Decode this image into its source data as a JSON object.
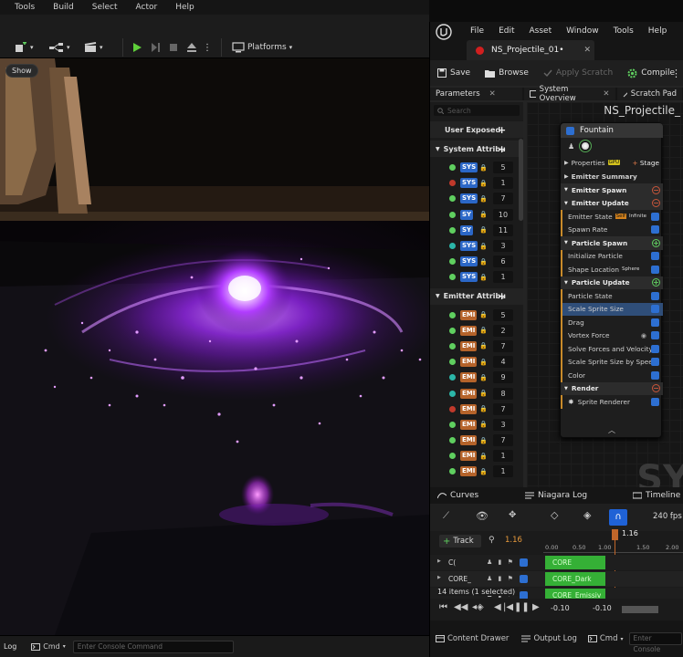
{
  "ue_menu": [
    "Tools",
    "Build",
    "Select",
    "Actor",
    "Help"
  ],
  "ue_toolbar": {
    "platforms_label": "Platforms"
  },
  "viewport": {
    "show_label": "Show"
  },
  "ue_bottom": {
    "log_label": "Log",
    "cmd_label": "Cmd",
    "console_placeholder": "Enter Console Command"
  },
  "niagara": {
    "menu": [
      "File",
      "Edit",
      "Asset",
      "Window",
      "Tools",
      "Help"
    ],
    "asset_tab": "NS_Projectile_01•",
    "toolbar": {
      "save": "Save",
      "browse": "Browse",
      "apply_scratch": "Apply Scratch",
      "compile": "Compile"
    },
    "panel_tabs": [
      "Parameters",
      "System Overview",
      "Scratch Pad"
    ],
    "search_placeholder": "Search",
    "graph_title": "NS_Projectile_",
    "watermark": "SY",
    "params": {
      "user_exposed": "User Exposed",
      "system_section": "System Attribu",
      "system_rows": [
        {
          "tag": "SYS",
          "val": "5",
          "dot": "#5fcf5f"
        },
        {
          "tag": "SYS",
          "val": "1",
          "dot": "#c0392b"
        },
        {
          "tag": "SYS",
          "val": "7",
          "dot": "#5fcf5f"
        },
        {
          "tag": "SY",
          "val": "10",
          "dot": "#5fcf5f"
        },
        {
          "tag": "SY",
          "val": "11",
          "dot": "#5fcf5f"
        },
        {
          "tag": "SYS",
          "val": "3",
          "dot": "#2bb6a8"
        },
        {
          "tag": "SYS",
          "val": "6",
          "dot": "#5fcf5f"
        },
        {
          "tag": "SYS",
          "val": "1",
          "dot": "#5fcf5f"
        }
      ],
      "emitter_section": "Emitter Attribu",
      "emitter_rows": [
        {
          "tag": "EMI",
          "val": "5",
          "dot": "#5fcf5f"
        },
        {
          "tag": "EMI",
          "val": "2",
          "dot": "#5fcf5f"
        },
        {
          "tag": "EMI",
          "val": "7",
          "dot": "#5fcf5f"
        },
        {
          "tag": "EMI",
          "val": "4",
          "dot": "#5fcf5f"
        },
        {
          "tag": "EMI",
          "val": "9",
          "dot": "#2bb6a8"
        },
        {
          "tag": "EMI",
          "val": "8",
          "dot": "#2bb6a8"
        },
        {
          "tag": "EMI",
          "val": "7",
          "dot": "#c0392b"
        },
        {
          "tag": "EMI",
          "val": "3",
          "dot": "#5fcf5f"
        },
        {
          "tag": "EMI",
          "val": "7",
          "dot": "#5fcf5f"
        },
        {
          "tag": "EMI",
          "val": "1",
          "dot": "#5fcf5f"
        },
        {
          "tag": "EMI",
          "val": "1",
          "dot": "#5fcf5f"
        }
      ]
    },
    "emitter": {
      "name": "Fountain",
      "properties": "Properties",
      "gpu_badge": "GPU",
      "stage": "Stage",
      "summary": "Emitter Summary",
      "rows": [
        {
          "label": "Emitter Spawn",
          "kind": "stage",
          "icon": "minus"
        },
        {
          "label": "Emitter Update",
          "kind": "stage",
          "icon": "minus"
        },
        {
          "label": "Emitter State",
          "kind": "item",
          "extra": "Self",
          "extra2": "Infinite"
        },
        {
          "label": "Spawn Rate",
          "kind": "item"
        },
        {
          "label": "Particle Spawn",
          "kind": "stage",
          "icon": "plus"
        },
        {
          "label": "Initialize Particle",
          "kind": "item"
        },
        {
          "label": "Shape Location",
          "kind": "item",
          "extra2": "Sphere"
        },
        {
          "label": "Particle Update",
          "kind": "stage",
          "icon": "plus"
        },
        {
          "label": "Particle State",
          "kind": "item"
        },
        {
          "label": "Scale Sprite Size",
          "kind": "selected"
        },
        {
          "label": "Drag",
          "kind": "item"
        },
        {
          "label": "Vortex Force",
          "kind": "item"
        },
        {
          "label": "Solve Forces and Velocity",
          "kind": "item"
        },
        {
          "label": "Scale Sprite Size by Speed",
          "kind": "item"
        },
        {
          "label": "Color",
          "kind": "item"
        },
        {
          "label": "Render",
          "kind": "stage",
          "icon": "minus"
        },
        {
          "label": "Sprite Renderer",
          "kind": "item"
        }
      ]
    },
    "timeline": {
      "tabs": [
        "Curves",
        "Niagara Log",
        "Timeline"
      ],
      "fps": "240 fps",
      "track_label": "Track",
      "time": "1.16",
      "ruler": [
        "0.00",
        "0.50",
        "1.00",
        "1.50",
        "2.00"
      ],
      "playhead_label": "1.16",
      "tracks": [
        {
          "label": "C(",
          "clip": "CORE"
        },
        {
          "label": "CORE_",
          "clip": "CORE_Dark"
        },
        {
          "label": "",
          "clip": "CORE_Emissiv"
        }
      ],
      "items_info": "14 items (1 selected)",
      "range_start": "-0.10",
      "range_end": "-0.10"
    },
    "bottom": {
      "content_drawer": "Content Drawer",
      "output_log": "Output Log",
      "cmd": "Cmd",
      "console_placeholder": "Enter Console"
    }
  }
}
